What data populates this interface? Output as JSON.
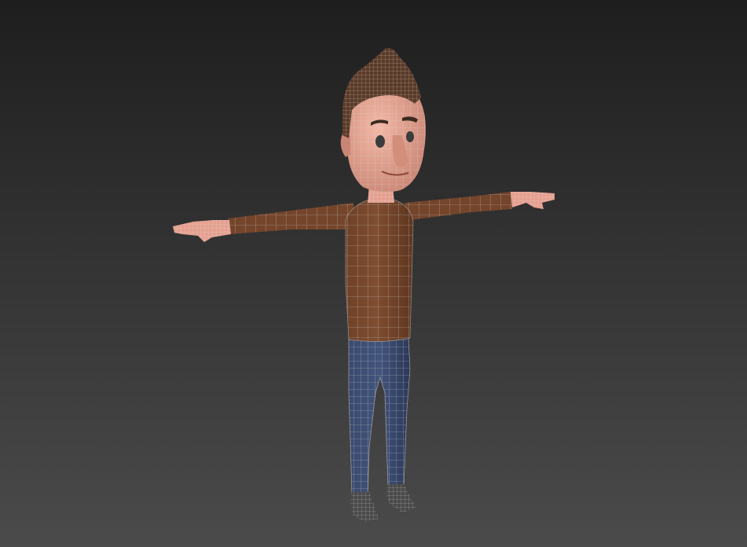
{
  "viewport": {
    "shading_mode": "wireframe-over-shaded",
    "background_top": "#1f1f1f",
    "background_bottom": "#4a4a4a"
  },
  "model": {
    "pose": "T-pose",
    "colors": {
      "skin": "#e8a493",
      "skin_shadow": "#c07a6a",
      "hair": "#5a3a28",
      "sweater": "#7a4a2e",
      "sweater_shadow": "#5e3620",
      "jeans": "#3a4a6e",
      "jeans_shadow": "#2a3652",
      "shoes": "#4a4a4a",
      "wire": "#d8d8d8",
      "eye": "#3c3c3c"
    }
  }
}
